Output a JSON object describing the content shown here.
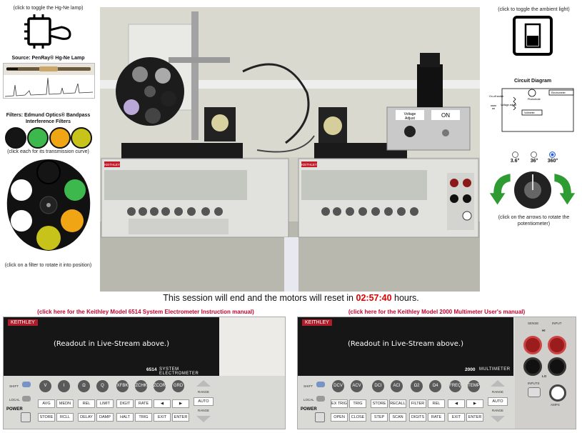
{
  "left": {
    "lamp_toggle_caption": "(click to toggle the Hg-Ne lamp)",
    "source_caption": "Source: PenRay® Hg-Ne Lamp",
    "filters_caption_1": "Filters: Edmund Optics® Bandpass",
    "filters_caption_2": "Interference Filters",
    "filters_hint": "(click each for its transmission curve)",
    "filter_colors": [
      "#151515",
      "#3cb84c",
      "#f0a514",
      "#c7c31a"
    ],
    "wheel_hint": "(click on a filter to rotate it into position)"
  },
  "right": {
    "ambient_caption": "(click to toggle the ambient light)",
    "circuit_title": "Circuit Diagram",
    "circuit_labels": {
      "switch": "On-off switch",
      "voltage": "Voltage adjust",
      "photodiode": "Photodiode",
      "voltmeter": "Voltmeter",
      "electrometer": "Electrometer"
    },
    "angles": [
      "3.6°",
      "36°",
      "360°"
    ],
    "selected_angle_index": 2,
    "pot_hint_1": "(click on the arrows to rotate the",
    "pot_hint_2": "potentiometer)"
  },
  "camera": {
    "box_label_1": "Voltage",
    "box_label_2": "Adjust",
    "on_label": "ON",
    "brand": "KEITHLEY"
  },
  "session": {
    "prefix": "This session will end and the motors will reset in ",
    "time": "02:57:40",
    "suffix": " hours."
  },
  "electrometer": {
    "manual_link": "(click here for the Keithley Model 6514 System Electrometer Instruction manual)",
    "brand": "KEITHLEY",
    "readout": "(Readout in Live-Stream above.)",
    "model": "6514",
    "model_name": "SYSTEM ELECTROMETER",
    "buttons_row1": [
      "V",
      "I",
      "Ω",
      "Q",
      "XFBK",
      "ZCHK",
      "ZCOR",
      "GRD"
    ],
    "buttons_row2": [
      "AVG",
      "MEDN",
      "DIGIT",
      "RATE"
    ],
    "buttons_row3": [
      "STORE",
      "RCLL",
      "DELAY",
      "DAMP",
      "HALT",
      "TRIG",
      "EXIT",
      "ENTER"
    ],
    "labels": [
      "SHIFT",
      "LOCAL",
      "POWER",
      "REL",
      "LIMIT",
      "RANGE",
      "AUTO",
      "RANGE"
    ]
  },
  "multimeter": {
    "manual_link": "(click here for the Keithley Model 2000 Multimeter User's manual)",
    "brand": "KEITHLEY",
    "readout": "(Readout in Live-Stream above.)",
    "model": "2000",
    "model_name": "MULTIMETER",
    "buttons_row1": [
      "DCV",
      "ACV",
      "DCI",
      "ACI",
      "Ω2",
      "Ω4",
      "FREQ",
      "TEMP"
    ],
    "buttons_row2": [
      "EX TRIG",
      "TRIG",
      "STORE",
      "RECALL",
      "FILTER",
      "REL"
    ],
    "buttons_row3": [
      "OPEN",
      "CLOSE",
      "STEP",
      "SCAN",
      "DIGITS",
      "RATE",
      "EXIT",
      "ENTER"
    ],
    "labels": [
      "SHIFT",
      "LOCAL",
      "POWER",
      "RANGE",
      "AUTO",
      "RANGE",
      "INPUTS",
      "SENSE",
      "INPUT",
      "HI",
      "LO",
      "AMPS"
    ]
  }
}
